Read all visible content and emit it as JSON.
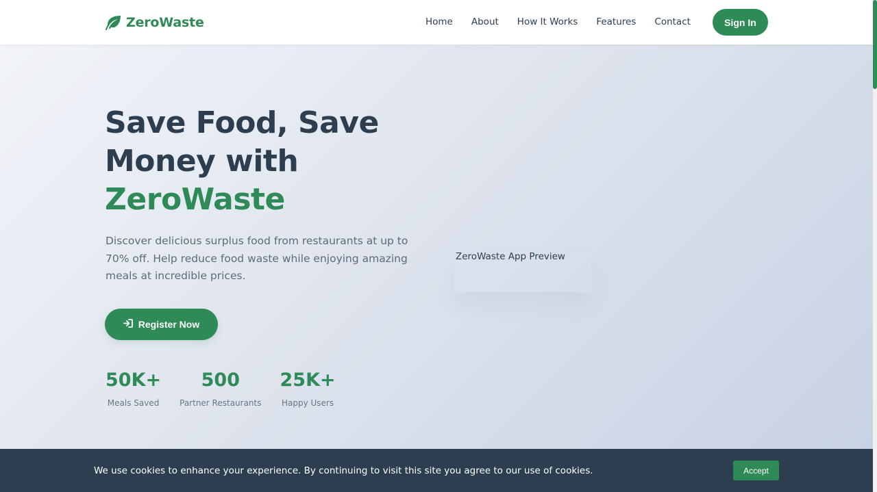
{
  "brand": {
    "name": "ZeroWaste",
    "icon": "leaf-icon"
  },
  "nav": {
    "links": [
      "Home",
      "About",
      "How It Works",
      "Features",
      "Contact"
    ],
    "signin_label": "Sign In"
  },
  "hero": {
    "title_line1": "Save Food, Save",
    "title_line2": "Money with",
    "title_accent": "ZeroWaste",
    "description": "Discover delicious surplus food from restaurants at up to 70% off. Help reduce food waste while enjoying amazing meals at incredible prices.",
    "register_label": "Register Now",
    "register_icon": "sign-in-icon",
    "preview_alt": "ZeroWaste App Preview"
  },
  "stats": [
    {
      "value": "50K+",
      "label": "Meals Saved"
    },
    {
      "value": "500",
      "label": "Partner Restaurants"
    },
    {
      "value": "25K+",
      "label": "Happy Users"
    }
  ],
  "cookie": {
    "text": "We use cookies to enhance your experience. By continuing to visit this site you agree to our use of cookies.",
    "accept_label": "Accept"
  },
  "colors": {
    "brand_green": "#2e8b57",
    "dark_navy": "#2c3e50"
  }
}
